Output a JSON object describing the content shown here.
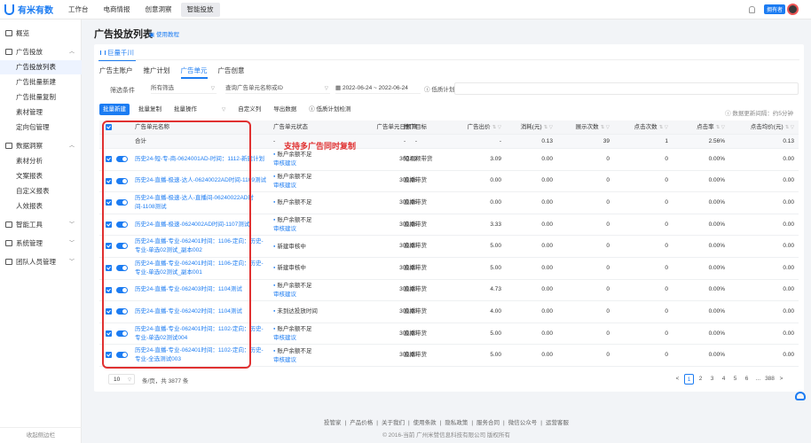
{
  "app": {
    "logo": "有米有数"
  },
  "topnav": {
    "items": [
      "工作台",
      "电商情报",
      "创意洞察",
      "智能投放"
    ],
    "user_tag": "拥有者"
  },
  "sidebar": {
    "overview": "概览",
    "ads": "广告投放",
    "ads_items": [
      "广告投放列表",
      "广告批量新建",
      "广告批量复制",
      "素材管理",
      "定向包管理"
    ],
    "insight": "数据洞察",
    "insight_items": [
      "素材分析",
      "文案报表",
      "自定义报表",
      "人效报表"
    ],
    "tools": "智能工具",
    "system": "系统管理",
    "team": "团队人员管理",
    "collapse": "收起侧边栏"
  },
  "page": {
    "title": "广告投放列表",
    "help": "使用教程",
    "brand_tab": "巨量千川",
    "level_tabs": [
      "广告主账户",
      "推广计划",
      "广告单元",
      "广告创意"
    ],
    "active_level_tab": "广告单元"
  },
  "filter": {
    "label": "筛选条件",
    "select1": "所有筛选",
    "select2": "查询广告单元名称或ID",
    "date_range": "2022-06-24 ~ 2022-06-24",
    "low_plan": "低质计划"
  },
  "toolbar": {
    "create": "批量新建",
    "copy": "批量复制",
    "ops": "批量操作",
    "custom_cols": "自定义列",
    "export": "导出数据",
    "low_check": "低质计划检测",
    "update_time": "数据更新间隔：约5分钟"
  },
  "table": {
    "headers": [
      "广告单元名称",
      "广告单元状态",
      "广告单元日预算",
      "推广目标",
      "广告出价",
      "消耗(元)",
      "展示次数",
      "点击次数",
      "点击率",
      "点击均价(元)"
    ],
    "total": {
      "label": "合计",
      "status": "-",
      "budget": "-",
      "target": "-",
      "bid": "-",
      "cost": "0.13",
      "impr": "39",
      "clicks": "1",
      "ctr": "2.56%",
      "cpc": "0.13"
    },
    "rows": [
      {
        "name": "历史24-短-专-商-0624001AD-时间：1112-新建计划",
        "status": "账户余额不足",
        "status2": "审核建议",
        "budget": "300.09",
        "target": "短视频带货",
        "bid": "3.09",
        "cost": "0.00",
        "impr": "0",
        "clicks": "0",
        "ctr": "0.00%",
        "cpc": "0.00"
      },
      {
        "name": "历史24-直播-极速-达人-06240022AD时间-1109测试",
        "status": "账户余额不足",
        "status2": "审核建议",
        "budget": "300.06",
        "target": "直播带货",
        "bid": "0.00",
        "cost": "0.00",
        "impr": "0",
        "clicks": "0",
        "ctr": "0.00%",
        "cpc": "0.00"
      },
      {
        "name": "历史24-直播-极速-达人-直播间-06240022AD时间-1108测试",
        "status": "账户余额不足",
        "status2": "",
        "budget": "300.06",
        "target": "直播带货",
        "bid": "0.00",
        "cost": "0.00",
        "impr": "0",
        "clicks": "0",
        "ctr": "0.00%",
        "cpc": "0.00"
      },
      {
        "name": "历史24-直播-极速-0624002AD时间-1107测试",
        "status": "账户余额不足",
        "status2": "审核建议",
        "budget": "300.06",
        "target": "直播带货",
        "bid": "3.33",
        "cost": "0.00",
        "impr": "0",
        "clicks": "0",
        "ctr": "0.00%",
        "cpc": "0.00"
      },
      {
        "name": "历史24-直播-专业-062401时间：1106-定向：历史-专业-单选02测试_副本002",
        "status": "新建审核中",
        "status2": "",
        "budget": "300.00",
        "target": "直播带货",
        "bid": "5.00",
        "cost": "0.00",
        "impr": "0",
        "clicks": "0",
        "ctr": "0.00%",
        "cpc": "0.00"
      },
      {
        "name": "历史24-直播-专业-062401时间：1106-定向：历史-专业-单选02测试_副本001",
        "status": "新建审核中",
        "status2": "",
        "budget": "300.00",
        "target": "直播带货",
        "bid": "5.00",
        "cost": "0.00",
        "impr": "0",
        "clicks": "0",
        "ctr": "0.00%",
        "cpc": "0.00"
      },
      {
        "name": "历史24-直播-专业-062403时间：1104测试",
        "status": "账户余额不足",
        "status2": "审核建议",
        "budget": "300.00",
        "target": "直播带货",
        "bid": "4.73",
        "cost": "0.00",
        "impr": "0",
        "clicks": "0",
        "ctr": "0.00%",
        "cpc": "0.00"
      },
      {
        "name": "历史24-直播-专业-062402时间：1104测试",
        "status": "未到达投放时间",
        "status2": "",
        "budget": "300.00",
        "target": "直播带货",
        "bid": "4.00",
        "cost": "0.00",
        "impr": "0",
        "clicks": "0",
        "ctr": "0.00%",
        "cpc": "0.00"
      },
      {
        "name": "历史24-直播-专业-062401时间：1102-定向：历史-专业-单选02测试004",
        "status": "账户余额不足",
        "status2": "审核建议",
        "budget": "300.00",
        "target": "直播带货",
        "bid": "5.00",
        "cost": "0.00",
        "impr": "0",
        "clicks": "0",
        "ctr": "0.00%",
        "cpc": "0.00"
      },
      {
        "name": "历史24-直播-专业-062401时间：1102-定向：历史-专业-全选测试003",
        "status": "账户余额不足",
        "status2": "审核建议",
        "budget": "300.00",
        "target": "直播带货",
        "bid": "5.00",
        "cost": "0.00",
        "impr": "0",
        "clicks": "0",
        "ctr": "0.00%",
        "cpc": "0.00"
      }
    ]
  },
  "annotation": "支持多广告同时复制",
  "pager": {
    "size": "10",
    "text": "条/页，共 3877 条",
    "pages": [
      "<",
      "1",
      "2",
      "3",
      "4",
      "5",
      "6",
      "...",
      "388",
      ">"
    ],
    "active": "1"
  },
  "footer": {
    "links": [
      "投管家",
      "产品价格",
      "关于我们",
      "使用条款",
      "隐私政策",
      "服务合同",
      "微信公众号",
      "运营客服"
    ],
    "copyright": "© 2016-当前 广州米赞信息科技有限公司 版权所有"
  }
}
